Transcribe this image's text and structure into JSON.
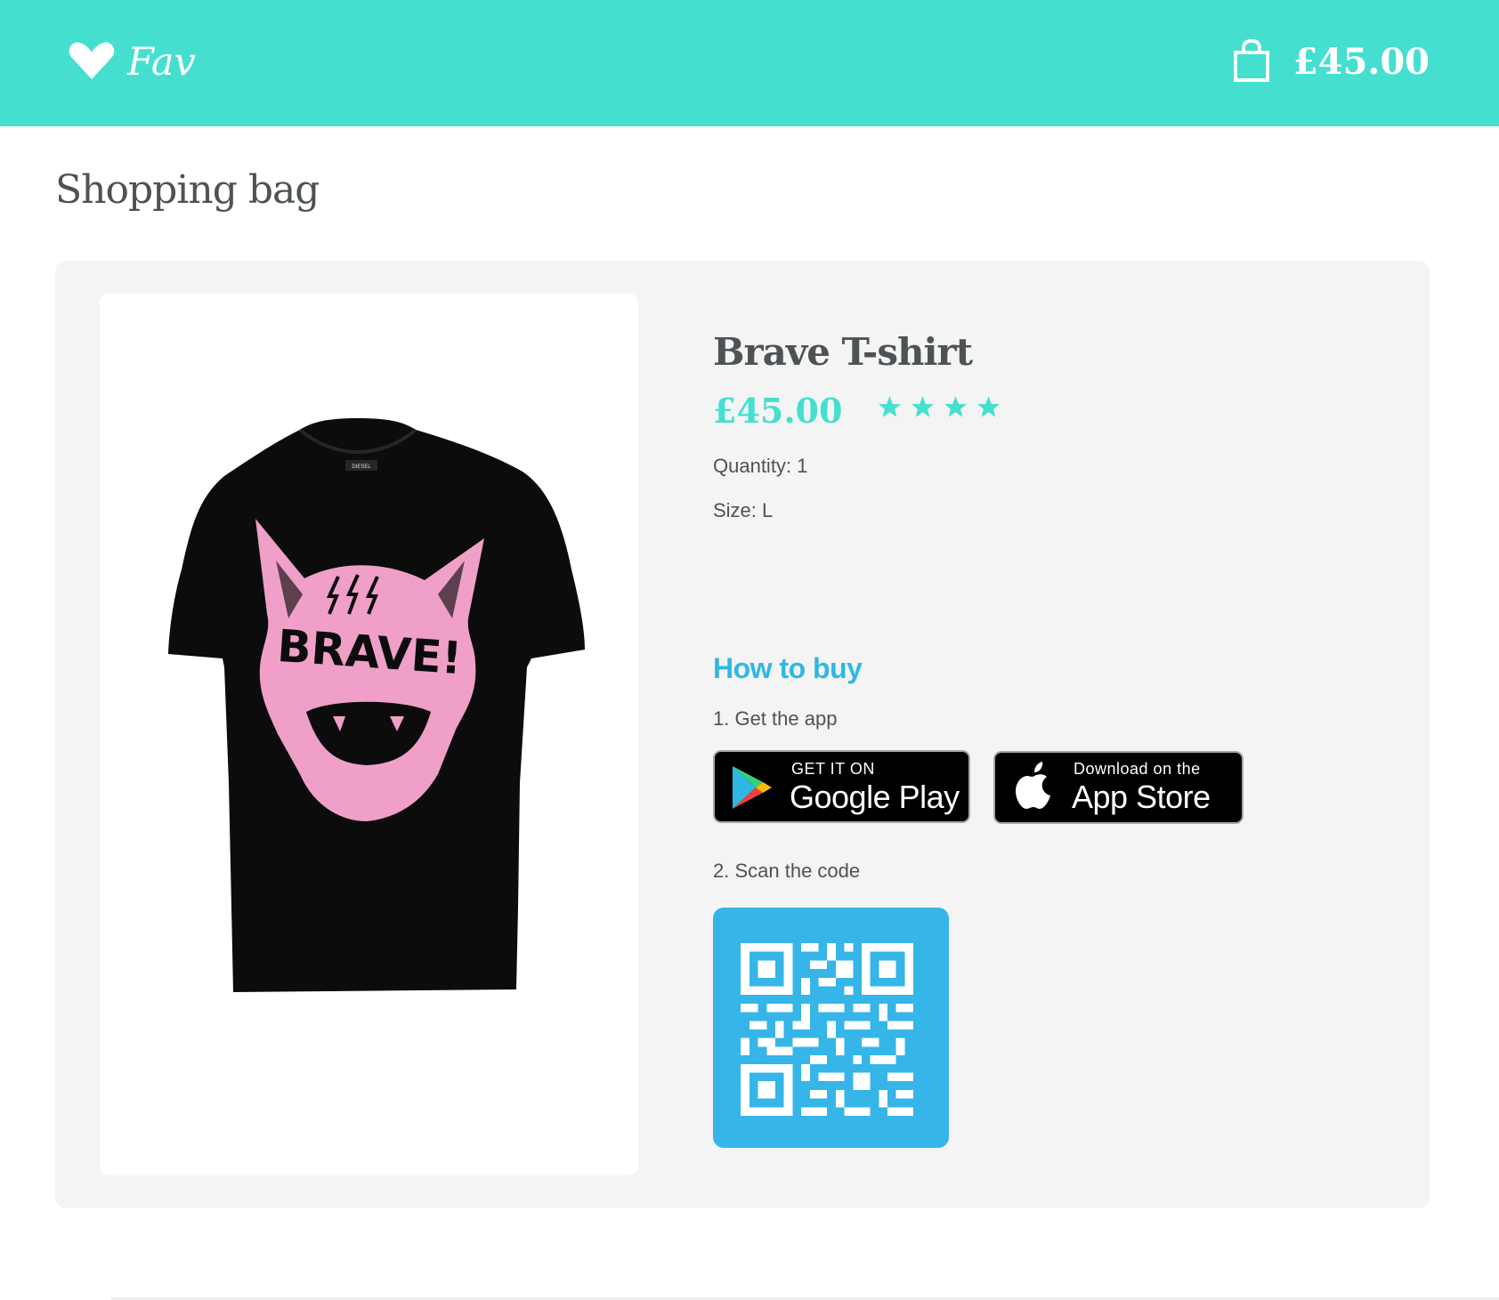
{
  "header": {
    "brand_name": "Fav",
    "brand_icon": "heart-icon",
    "bag_icon": "shopping-bag-icon",
    "bag_total": "£45.00",
    "background_color": "#45dfd0"
  },
  "page": {
    "title": "Shopping bag"
  },
  "product": {
    "name": "Brave T-shirt",
    "price": "£45.00",
    "rating": 4,
    "rating_max": 4,
    "quantity": "Quantity: 1",
    "size": "Size: L",
    "image": {
      "print_text": "BRAVE!",
      "brand_text": "DIESEL"
    }
  },
  "how_to_buy": {
    "title": "How to buy",
    "step1": "1. Get the app",
    "step2": "2. Scan the code",
    "google_play": {
      "small": "GET IT ON",
      "big": "Google Play",
      "icon": "google-play-icon"
    },
    "app_store": {
      "small": "Download on the",
      "big": "App Store",
      "icon": "apple-icon"
    },
    "qr_color": "#35b5e8"
  },
  "colors": {
    "accent": "#45dfd0",
    "link_blue": "#2fb8e3",
    "text_dark": "#4d5355"
  }
}
